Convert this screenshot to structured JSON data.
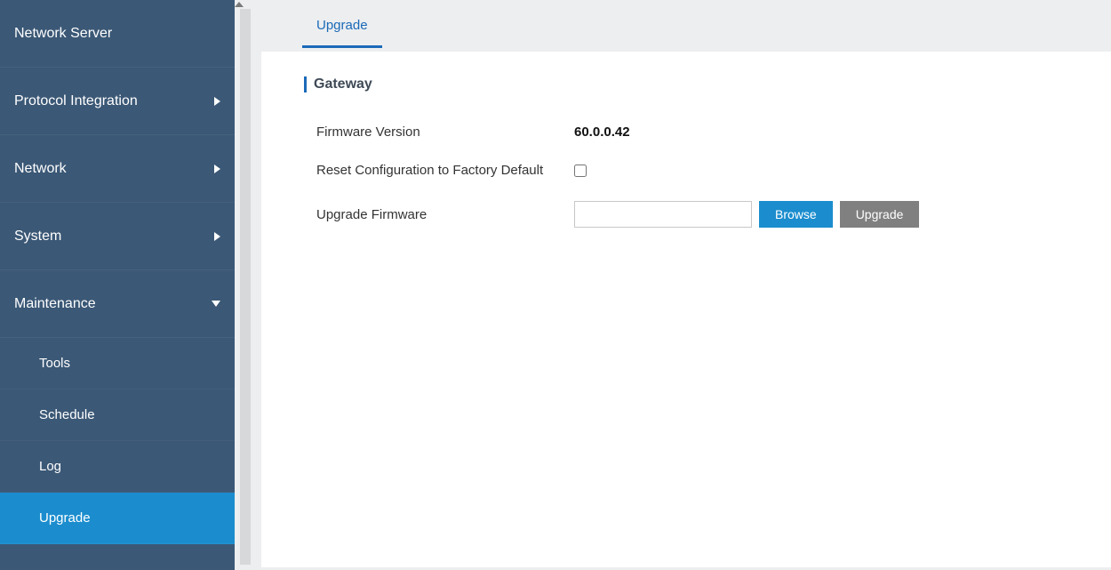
{
  "sidebar": {
    "items": [
      {
        "label": "Network Server",
        "hasSubmenu": false
      },
      {
        "label": "Protocol Integration",
        "hasSubmenu": true
      },
      {
        "label": "Network",
        "hasSubmenu": true
      },
      {
        "label": "System",
        "hasSubmenu": true
      },
      {
        "label": "Maintenance",
        "hasSubmenu": true,
        "expanded": true
      }
    ],
    "maintenanceSub": [
      {
        "label": "Tools"
      },
      {
        "label": "Schedule"
      },
      {
        "label": "Log"
      },
      {
        "label": "Upgrade"
      }
    ]
  },
  "tabs": {
    "active": "Upgrade"
  },
  "section": {
    "title": "Gateway"
  },
  "form": {
    "firmwareVersionLabel": "Firmware Version",
    "firmwareVersionValue": "60.0.0.42",
    "resetLabel": "Reset Configuration to Factory Default",
    "upgradeLabel": "Upgrade Firmware",
    "fileValue": "",
    "browseBtn": "Browse",
    "upgradeBtn": "Upgrade"
  }
}
